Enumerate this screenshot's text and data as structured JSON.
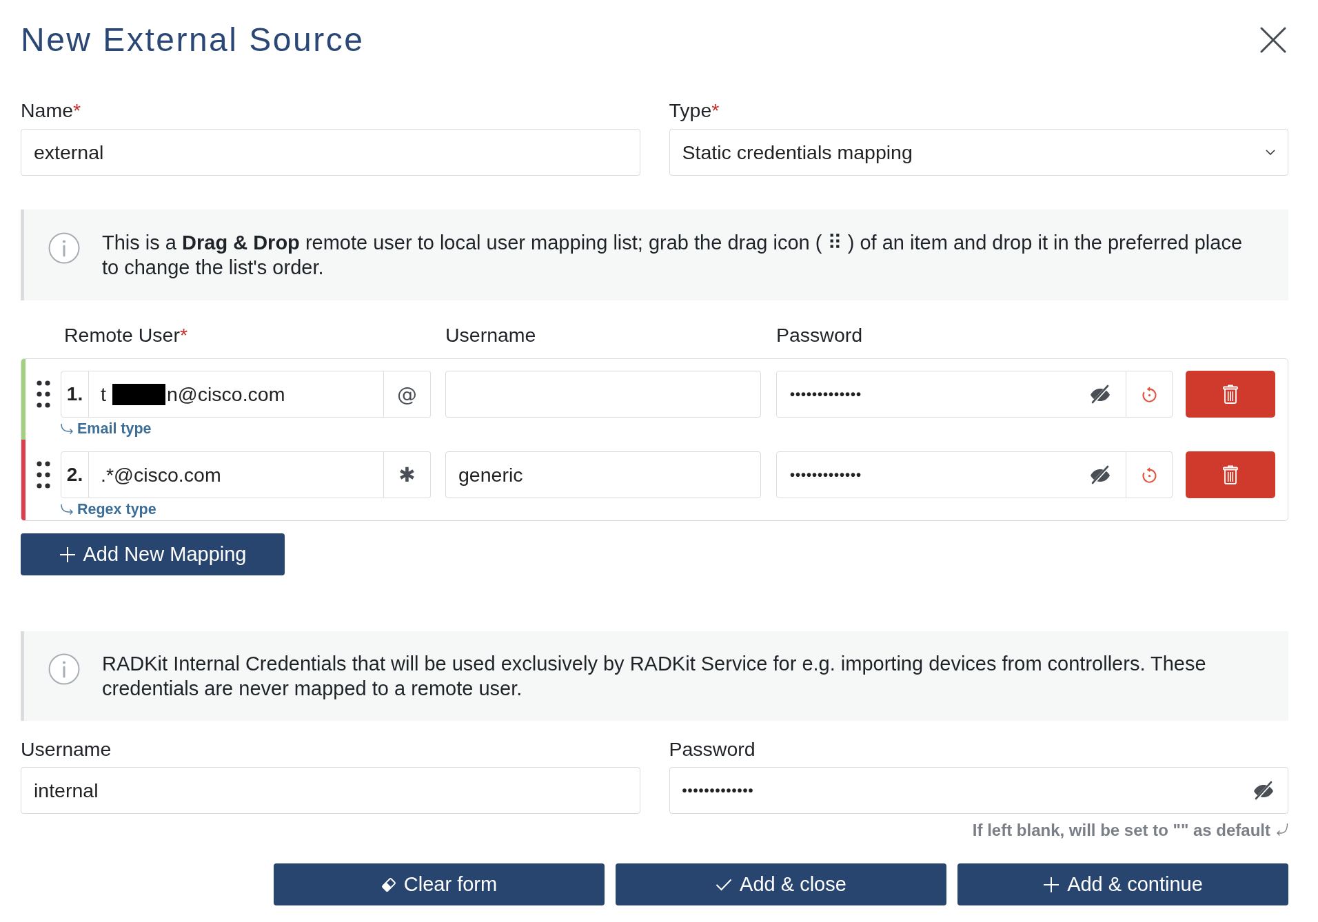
{
  "dialog": {
    "title": "New External Source"
  },
  "source_fields": [
    {
      "kind": "text",
      "label": "Name",
      "required_mark": "*",
      "value": "external"
    },
    {
      "kind": "select",
      "label": "Type",
      "required_mark": "*",
      "value": "Static credentials mapping"
    }
  ],
  "mapping_info": {
    "text": "This is a **Drag & Drop** remote user to local user mapping list; grab the drag icon ( ⠿ ) of an item and drop it in the preferred place to change the list's order."
  },
  "mapping_list": {
    "columns": [
      {
        "label": "Remote User",
        "required_mark": "*"
      },
      {
        "label": "Username"
      },
      {
        "label": "Password"
      }
    ],
    "rows": [
      {
        "index": "1.",
        "color": "#a3d07f",
        "remote_user": {
          "value": "t",
          "redacted": true,
          "value_after_redaction": "n@cisco.com"
        },
        "type_symbol": "@",
        "type_hint": "Email type",
        "password": "•••••••••••••"
      },
      {
        "index": "2.",
        "color": "#dc3c4b",
        "remote_user": {
          "value": ".*@cisco.com"
        },
        "type_symbol": "✱",
        "type_hint": "Regex type",
        "username": "generic",
        "password": "•••••••••••••"
      }
    ]
  },
  "add_mapping_button": {
    "label": "Add New Mapping"
  },
  "internal_info": {
    "text": "RADKit Internal Credentials that will be used exclusively by RADKit Service for e.g. importing devices from controllers. These credentials are never mapped to a remote user."
  },
  "internal_credentials": {
    "fields": [
      {
        "kind": "text",
        "label": "Username",
        "value": "internal"
      },
      {
        "kind": "password",
        "label": "Password",
        "value": "•••••••••••••"
      }
    ],
    "hint": "If left blank, will be set to \"\" as default"
  },
  "actions": [
    {
      "kind": "clear",
      "label": "Clear form"
    },
    {
      "kind": "close",
      "label": "Add & close"
    },
    {
      "kind": "continue",
      "label": "Add & continue"
    }
  ]
}
